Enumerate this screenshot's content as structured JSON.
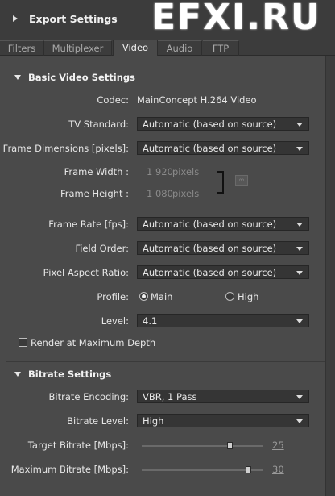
{
  "header": {
    "title": "Export Settings",
    "watermark": "EFXI.RU"
  },
  "tabs": [
    {
      "label": "Filters"
    },
    {
      "label": "Multiplexer"
    },
    {
      "label": "Video",
      "active": true
    },
    {
      "label": "Audio"
    },
    {
      "label": "FTP"
    }
  ],
  "basic": {
    "title": "Basic Video Settings",
    "codec_label": "Codec:",
    "codec_value": "MainConcept H.264 Video",
    "tv_label": "TV Standard:",
    "tv_value": "Automatic (based on source)",
    "frame_dim_label": "Frame Dimensions [pixels]:",
    "frame_dim_value": "Automatic (based on source)",
    "frame_width_label": "Frame Width :",
    "frame_width_value": "1 920",
    "frame_width_unit": "pixels",
    "frame_height_label": "Frame Height :",
    "frame_height_value": "1 080",
    "frame_height_unit": "pixels",
    "link_icon": "∞",
    "frame_rate_label": "Frame Rate [fps]:",
    "frame_rate_value": "Automatic (based on source)",
    "field_order_label": "Field Order:",
    "field_order_value": "Automatic (based on source)",
    "par_label": "Pixel Aspect Ratio:",
    "par_value": "Automatic (based on source)",
    "profile_label": "Profile:",
    "profile_main": "Main",
    "profile_high": "High",
    "level_label": "Level:",
    "level_value": "4.1",
    "render_max_label": "Render at Maximum Depth"
  },
  "bitrate": {
    "title": "Bitrate Settings",
    "encoding_label": "Bitrate Encoding:",
    "encoding_value": "VBR, 1 Pass",
    "level_label": "Bitrate Level:",
    "level_value": "High",
    "target_label": "Target Bitrate [Mbps]:",
    "target_value": "25",
    "max_label": "Maximum Bitrate [Mbps]:",
    "max_value": "30"
  }
}
